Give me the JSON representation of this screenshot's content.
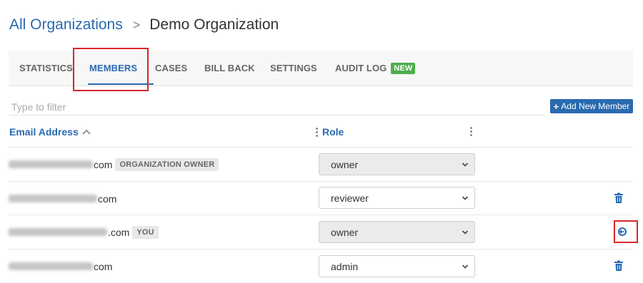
{
  "breadcrumb": {
    "parent": "All Organizations",
    "separator": ">",
    "current": "Demo Organization"
  },
  "tabs": [
    {
      "label": "STATISTICS",
      "active": false
    },
    {
      "label": "MEMBERS",
      "active": true
    },
    {
      "label": "CASES",
      "active": false
    },
    {
      "label": "BILL BACK",
      "active": false
    },
    {
      "label": "SETTINGS",
      "active": false
    },
    {
      "label": "AUDIT LOG",
      "active": false,
      "badge": "NEW"
    }
  ],
  "filter": {
    "placeholder": "Type to filter",
    "value": ""
  },
  "add_member_button": {
    "label": "Add New Member",
    "icon": "plus-icon"
  },
  "table": {
    "columns": [
      {
        "label": "Email Address",
        "sort": "ascending"
      },
      {
        "label": "Role"
      }
    ],
    "rows": [
      {
        "email_visible_suffix": "com",
        "tag": "ORGANIZATION OWNER",
        "role": "owner",
        "role_editable": false,
        "action": null
      },
      {
        "email_visible_suffix": "com",
        "tag": null,
        "role": "reviewer",
        "role_editable": true,
        "action": "trash-icon"
      },
      {
        "email_visible_suffix": ".com",
        "tag": "YOU",
        "role": "owner",
        "role_editable": false,
        "action": "leave-icon"
      },
      {
        "email_visible_suffix": "com",
        "tag": null,
        "role": "admin",
        "role_editable": true,
        "action": "trash-icon"
      }
    ]
  },
  "colors": {
    "accent": "#2a6ab0",
    "new_badge": "#4cae4c",
    "highlight": "#d9252a"
  }
}
